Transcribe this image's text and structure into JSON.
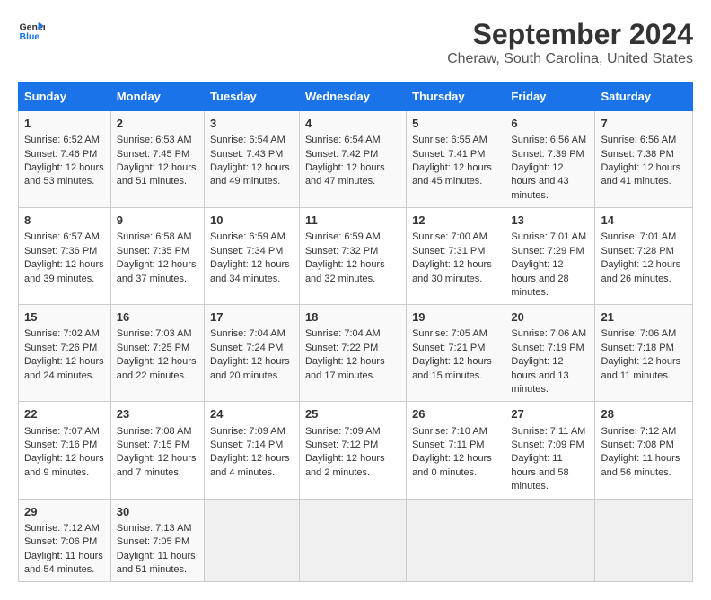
{
  "logo": {
    "line1": "General",
    "line2": "Blue"
  },
  "title": "September 2024",
  "subtitle": "Cheraw, South Carolina, United States",
  "days_of_week": [
    "Sunday",
    "Monday",
    "Tuesday",
    "Wednesday",
    "Thursday",
    "Friday",
    "Saturday"
  ],
  "weeks": [
    [
      {
        "day": "1",
        "sunrise": "Sunrise: 6:52 AM",
        "sunset": "Sunset: 7:46 PM",
        "daylight": "Daylight: 12 hours and 53 minutes."
      },
      {
        "day": "2",
        "sunrise": "Sunrise: 6:53 AM",
        "sunset": "Sunset: 7:45 PM",
        "daylight": "Daylight: 12 hours and 51 minutes."
      },
      {
        "day": "3",
        "sunrise": "Sunrise: 6:54 AM",
        "sunset": "Sunset: 7:43 PM",
        "daylight": "Daylight: 12 hours and 49 minutes."
      },
      {
        "day": "4",
        "sunrise": "Sunrise: 6:54 AM",
        "sunset": "Sunset: 7:42 PM",
        "daylight": "Daylight: 12 hours and 47 minutes."
      },
      {
        "day": "5",
        "sunrise": "Sunrise: 6:55 AM",
        "sunset": "Sunset: 7:41 PM",
        "daylight": "Daylight: 12 hours and 45 minutes."
      },
      {
        "day": "6",
        "sunrise": "Sunrise: 6:56 AM",
        "sunset": "Sunset: 7:39 PM",
        "daylight": "Daylight: 12 hours and 43 minutes."
      },
      {
        "day": "7",
        "sunrise": "Sunrise: 6:56 AM",
        "sunset": "Sunset: 7:38 PM",
        "daylight": "Daylight: 12 hours and 41 minutes."
      }
    ],
    [
      {
        "day": "8",
        "sunrise": "Sunrise: 6:57 AM",
        "sunset": "Sunset: 7:36 PM",
        "daylight": "Daylight: 12 hours and 39 minutes."
      },
      {
        "day": "9",
        "sunrise": "Sunrise: 6:58 AM",
        "sunset": "Sunset: 7:35 PM",
        "daylight": "Daylight: 12 hours and 37 minutes."
      },
      {
        "day": "10",
        "sunrise": "Sunrise: 6:59 AM",
        "sunset": "Sunset: 7:34 PM",
        "daylight": "Daylight: 12 hours and 34 minutes."
      },
      {
        "day": "11",
        "sunrise": "Sunrise: 6:59 AM",
        "sunset": "Sunset: 7:32 PM",
        "daylight": "Daylight: 12 hours and 32 minutes."
      },
      {
        "day": "12",
        "sunrise": "Sunrise: 7:00 AM",
        "sunset": "Sunset: 7:31 PM",
        "daylight": "Daylight: 12 hours and 30 minutes."
      },
      {
        "day": "13",
        "sunrise": "Sunrise: 7:01 AM",
        "sunset": "Sunset: 7:29 PM",
        "daylight": "Daylight: 12 hours and 28 minutes."
      },
      {
        "day": "14",
        "sunrise": "Sunrise: 7:01 AM",
        "sunset": "Sunset: 7:28 PM",
        "daylight": "Daylight: 12 hours and 26 minutes."
      }
    ],
    [
      {
        "day": "15",
        "sunrise": "Sunrise: 7:02 AM",
        "sunset": "Sunset: 7:26 PM",
        "daylight": "Daylight: 12 hours and 24 minutes."
      },
      {
        "day": "16",
        "sunrise": "Sunrise: 7:03 AM",
        "sunset": "Sunset: 7:25 PM",
        "daylight": "Daylight: 12 hours and 22 minutes."
      },
      {
        "day": "17",
        "sunrise": "Sunrise: 7:04 AM",
        "sunset": "Sunset: 7:24 PM",
        "daylight": "Daylight: 12 hours and 20 minutes."
      },
      {
        "day": "18",
        "sunrise": "Sunrise: 7:04 AM",
        "sunset": "Sunset: 7:22 PM",
        "daylight": "Daylight: 12 hours and 17 minutes."
      },
      {
        "day": "19",
        "sunrise": "Sunrise: 7:05 AM",
        "sunset": "Sunset: 7:21 PM",
        "daylight": "Daylight: 12 hours and 15 minutes."
      },
      {
        "day": "20",
        "sunrise": "Sunrise: 7:06 AM",
        "sunset": "Sunset: 7:19 PM",
        "daylight": "Daylight: 12 hours and 13 minutes."
      },
      {
        "day": "21",
        "sunrise": "Sunrise: 7:06 AM",
        "sunset": "Sunset: 7:18 PM",
        "daylight": "Daylight: 12 hours and 11 minutes."
      }
    ],
    [
      {
        "day": "22",
        "sunrise": "Sunrise: 7:07 AM",
        "sunset": "Sunset: 7:16 PM",
        "daylight": "Daylight: 12 hours and 9 minutes."
      },
      {
        "day": "23",
        "sunrise": "Sunrise: 7:08 AM",
        "sunset": "Sunset: 7:15 PM",
        "daylight": "Daylight: 12 hours and 7 minutes."
      },
      {
        "day": "24",
        "sunrise": "Sunrise: 7:09 AM",
        "sunset": "Sunset: 7:14 PM",
        "daylight": "Daylight: 12 hours and 4 minutes."
      },
      {
        "day": "25",
        "sunrise": "Sunrise: 7:09 AM",
        "sunset": "Sunset: 7:12 PM",
        "daylight": "Daylight: 12 hours and 2 minutes."
      },
      {
        "day": "26",
        "sunrise": "Sunrise: 7:10 AM",
        "sunset": "Sunset: 7:11 PM",
        "daylight": "Daylight: 12 hours and 0 minutes."
      },
      {
        "day": "27",
        "sunrise": "Sunrise: 7:11 AM",
        "sunset": "Sunset: 7:09 PM",
        "daylight": "Daylight: 11 hours and 58 minutes."
      },
      {
        "day": "28",
        "sunrise": "Sunrise: 7:12 AM",
        "sunset": "Sunset: 7:08 PM",
        "daylight": "Daylight: 11 hours and 56 minutes."
      }
    ],
    [
      {
        "day": "29",
        "sunrise": "Sunrise: 7:12 AM",
        "sunset": "Sunset: 7:06 PM",
        "daylight": "Daylight: 11 hours and 54 minutes."
      },
      {
        "day": "30",
        "sunrise": "Sunrise: 7:13 AM",
        "sunset": "Sunset: 7:05 PM",
        "daylight": "Daylight: 11 hours and 51 minutes."
      },
      null,
      null,
      null,
      null,
      null
    ]
  ]
}
